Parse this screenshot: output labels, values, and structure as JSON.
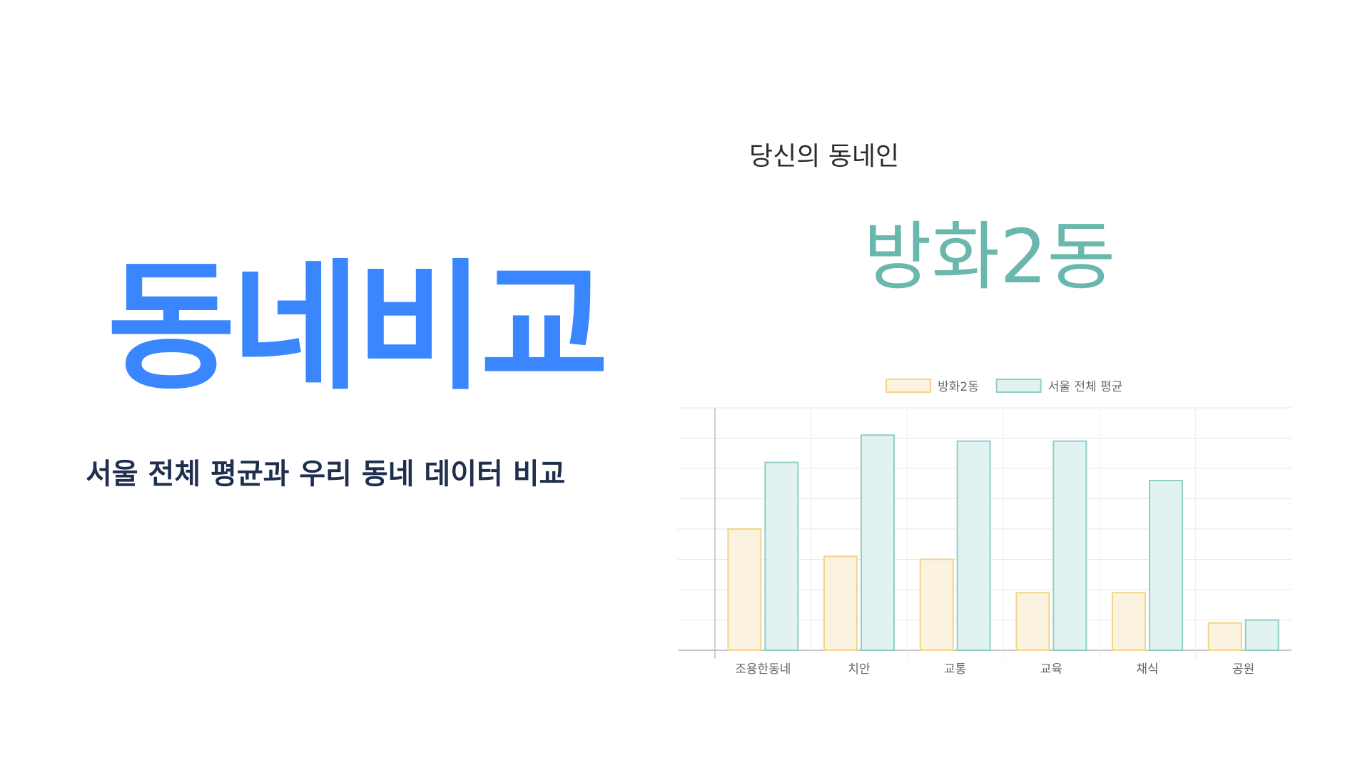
{
  "hero": {
    "title": "동네비교",
    "subtitle": "서울 전체 평균과 우리 동네 데이터 비교"
  },
  "caption": "당신의 동네인",
  "dong_name": "방화2동",
  "colors": {
    "title_blue": "#3a86ff",
    "subtitle_navy": "#1f2f4d",
    "dong_teal": "#6ab8ad",
    "series1_fill": "#fbf3df",
    "series1_stroke": "#f3d48a",
    "series2_fill": "#e2f2f0",
    "series2_stroke": "#8fcfc8"
  },
  "chart_data": {
    "type": "bar",
    "categories": [
      "조용한동네",
      "치안",
      "교통",
      "교육",
      "채식",
      "공원"
    ],
    "series": [
      {
        "name": "방화2동",
        "values": [
          40,
          31,
          30,
          19,
          19,
          9
        ]
      },
      {
        "name": "서울 전체 평균",
        "values": [
          62,
          71,
          69,
          69,
          56,
          10
        ]
      }
    ],
    "ylim": [
      0,
      80
    ],
    "grid": true,
    "legend": "top-center"
  }
}
